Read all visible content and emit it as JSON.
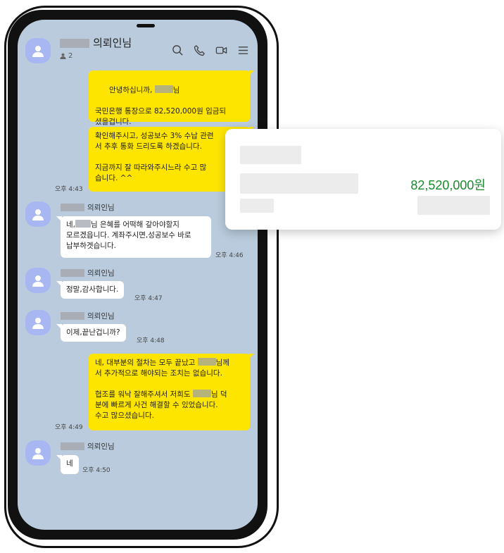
{
  "chat": {
    "title": "의뢰인님",
    "member_count": "2",
    "sender_name": "의뢰인님",
    "icons": [
      "search-icon",
      "phone-icon",
      "video-icon",
      "menu-icon"
    ]
  },
  "messages": {
    "m1_line1": "안녕하십니까,",
    "m1_line1_suffix": "님",
    "m1_body": "국민은행 통장으로 82,520,000원 입금되\n셨을겁니다.",
    "m2_body": "확인해주시고, 성공보수 3% 수납 관련\n서 추후 통화 드리도록 하겠습니다.\n\n지금까지 잘 따라와주시느라 수고 많\n습니다. ^^",
    "m2_time": "오후 4:43",
    "m3_prefix": "네,",
    "m3_rest": "님 은혜를 어떡해 갚아야할지\n모르겠읍니다. 계좌주시면,성공보수 바로\n납부하겟습니다.",
    "m3_time": "오후 4:46",
    "m4_body": "정말,감사합니다.",
    "m4_time": "오후 4:47",
    "m5_body": "이제,끝난겁니까?",
    "m5_time": "오후 4:48",
    "m6_prefix": "네, 대부분의 절차는 모두 끝났고",
    "m6_suffix": "님께",
    "m6_line2": "서 추가적으로 해야되는 조치는 없습니다.",
    "m6_line3_prefix": "협조를 워낙 잘해주셔서 저희도",
    "m6_line3_suffix": "님 덕",
    "m6_rest": "분에 빠르게 사건 해결할 수 있었습니다.\n수고 많으셨습니다.",
    "m6_time": "오후 4:49",
    "m7_body": "네",
    "m7_time": "오후 4:50"
  },
  "card": {
    "amount": "82,520,000원",
    "amount_color": "#1a8a2e"
  }
}
